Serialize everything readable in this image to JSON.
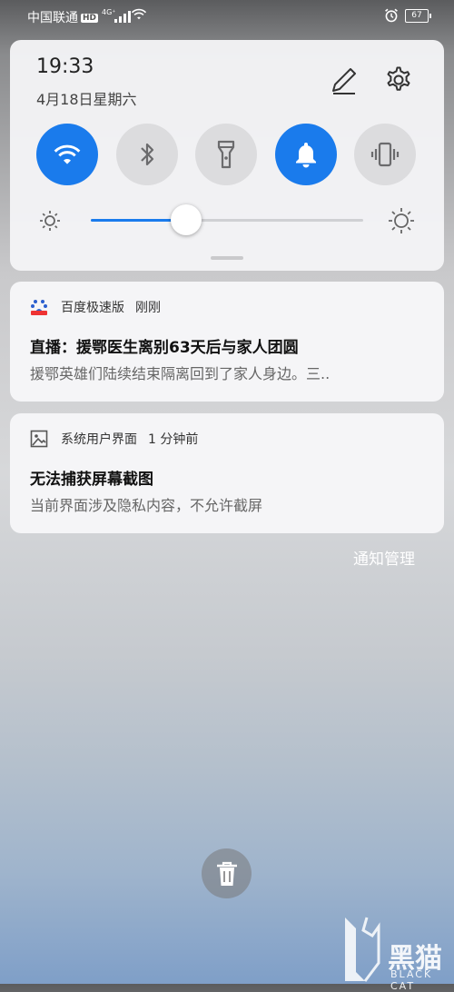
{
  "status_bar": {
    "carrier": "中国联通",
    "hd_badge": "HD",
    "network_type": "4G⁺",
    "battery_level": "67",
    "icons": [
      "signal-bars-icon",
      "wifi-icon",
      "alarm-clock-icon",
      "battery-icon"
    ]
  },
  "quick_settings": {
    "time": "19:33",
    "date": "4月18日星期六",
    "edit_icon": "pencil-icon",
    "settings_icon": "gear-icon",
    "tiles": [
      {
        "name": "wifi",
        "icon": "wifi-icon",
        "active": true
      },
      {
        "name": "bluetooth",
        "icon": "bluetooth-icon",
        "active": false
      },
      {
        "name": "flashlight",
        "icon": "flashlight-icon",
        "active": false
      },
      {
        "name": "sound",
        "icon": "bell-icon",
        "active": true
      },
      {
        "name": "vibrate",
        "icon": "vibrate-icon",
        "active": false
      }
    ],
    "brightness_fraction": 0.35,
    "accent_color": "#1a7bec"
  },
  "notifications": [
    {
      "app": "百度极速版",
      "time": "刚刚",
      "title": "直播：援鄂医生离别63天后与家人团圆",
      "body": "援鄂英雄们陆续结束隔离回到了家人身边。三.."
    },
    {
      "app": "系统用户界面",
      "time": "1 分钟前",
      "title": "无法捕获屏幕截图",
      "body": "当前界面涉及隐私内容，不允许截屏"
    }
  ],
  "notification_management": "通知管理",
  "clear_icon": "trash-icon",
  "watermark": {
    "text": "黑猫",
    "sub": "BLACK CAT"
  }
}
